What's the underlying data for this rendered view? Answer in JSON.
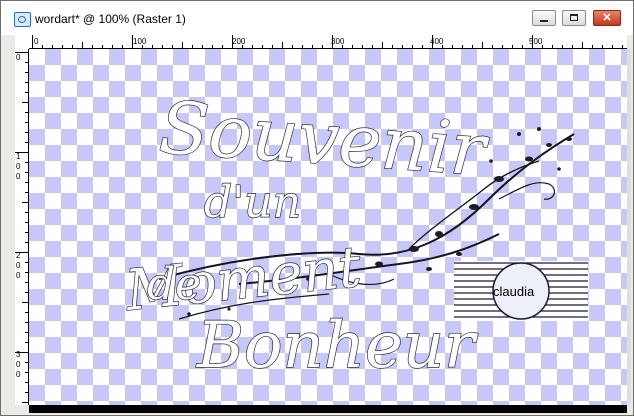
{
  "window": {
    "title": "wordart* @ 100% (Raster 1)",
    "controls": {
      "minimize": "minimize-icon",
      "maximize": "maximize-icon",
      "close": "close-icon"
    }
  },
  "ruler": {
    "horizontal_labels": [
      "0",
      "100",
      "200",
      "300",
      "400",
      "500"
    ],
    "vertical_labels": [
      "0",
      "1\n0\n0",
      "2\n0\n0",
      "3\n0\n0"
    ]
  },
  "artwork": {
    "line1": "Souvenir",
    "line1b": "d'un",
    "line2": "Moment",
    "line3": "de",
    "line4": "Bonheur",
    "watermark": "claudia"
  },
  "colors": {
    "checker_light": "#ffffff",
    "checker_dark": "#c8c8f8",
    "close_button": "#c23a1f"
  }
}
